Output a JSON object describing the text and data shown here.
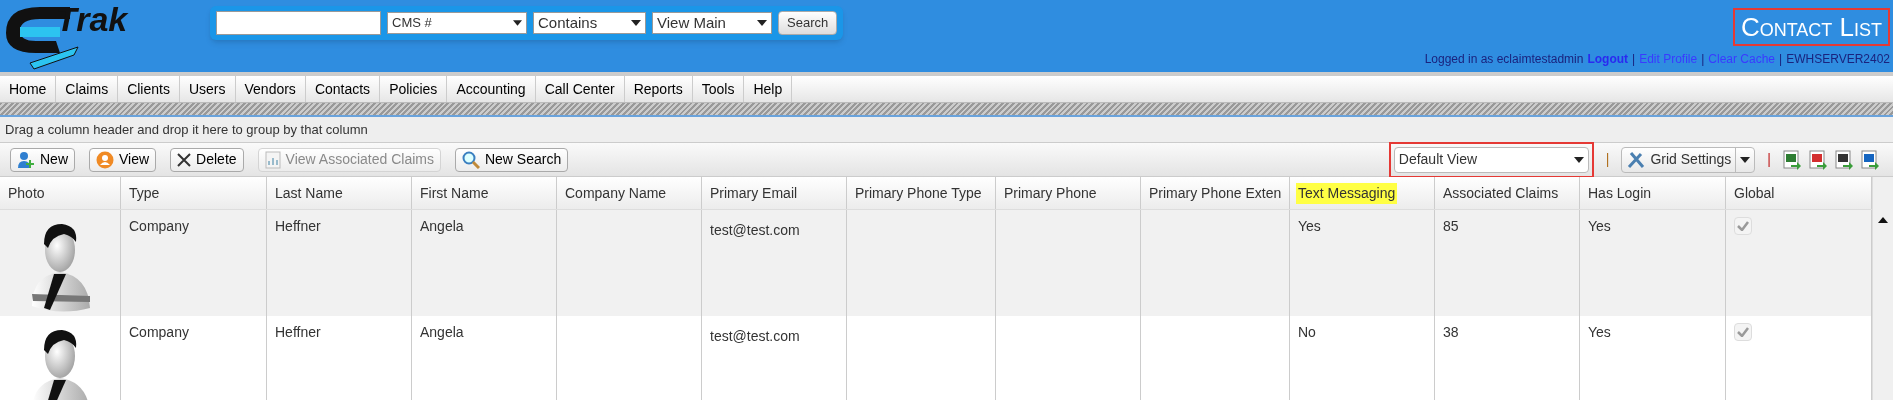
{
  "header": {
    "logo_text": "Trak",
    "search": {
      "field_select": "CMS #",
      "match_select": "Contains",
      "view_select": "View Main",
      "button": "Search"
    },
    "title": {
      "text": "Contact List",
      "outlined": true
    },
    "user_bar": [
      {
        "kind": "text",
        "text": "Logged in as eclaimtestadmin"
      },
      {
        "kind": "bold-link",
        "text": "Logout"
      },
      {
        "kind": "sep",
        "text": "|"
      },
      {
        "kind": "link",
        "text": "Edit Profile"
      },
      {
        "kind": "sep",
        "text": "|"
      },
      {
        "kind": "link",
        "text": "Clear Cache"
      },
      {
        "kind": "sep",
        "text": "|"
      },
      {
        "kind": "text",
        "text": "EWHSERVER2402"
      }
    ]
  },
  "menu": [
    "Home",
    "Claims",
    "Clients",
    "Users",
    "Vendors",
    "Contacts",
    "Policies",
    "Accounting",
    "Call Center",
    "Reports",
    "Tools",
    "Help"
  ],
  "group_panel": "Drag a column header and drop it here to group by that column",
  "toolbar": {
    "buttons": [
      {
        "kind": "new",
        "label": "New",
        "disabled": false
      },
      {
        "kind": "view",
        "label": "View",
        "disabled": false
      },
      {
        "kind": "delete",
        "label": "Delete",
        "disabled": false
      },
      {
        "kind": "claims",
        "label": "View Associated Claims",
        "disabled": true
      },
      {
        "kind": "search",
        "label": "New Search",
        "disabled": false
      }
    ],
    "view_select": {
      "value": "Default View",
      "outlined": true
    },
    "separators": [
      "|",
      "|"
    ],
    "grid_settings": "Grid Settings",
    "exports": [
      {
        "kind": "excel"
      },
      {
        "kind": "pdf"
      },
      {
        "kind": "csv"
      },
      {
        "kind": "word"
      }
    ]
  },
  "table": {
    "columns": [
      {
        "label": "Photo",
        "highlighted": false
      },
      {
        "label": "Type",
        "highlighted": false
      },
      {
        "label": "Last Name",
        "highlighted": false
      },
      {
        "label": "First Name",
        "highlighted": false
      },
      {
        "label": "Company Name",
        "highlighted": false
      },
      {
        "label": "Primary Email",
        "highlighted": false
      },
      {
        "label": "Primary Phone Type",
        "highlighted": false
      },
      {
        "label": "Primary Phone",
        "highlighted": false
      },
      {
        "label": "Primary Phone Exten",
        "highlighted": false
      },
      {
        "label": "Text Messaging",
        "highlighted": true
      },
      {
        "label": "Associated Claims",
        "highlighted": false
      },
      {
        "label": "Has Login",
        "highlighted": false
      },
      {
        "label": "Global",
        "highlighted": false
      }
    ],
    "rows": [
      {
        "selected": true,
        "type": "Company",
        "last_name": "Heffner",
        "first_name": "Angela",
        "primary_email": "test@test.com",
        "text_messaging": "Yes",
        "associated_claims": "85",
        "has_login": "Yes",
        "global": {
          "checked": true,
          "disabled": true
        }
      },
      {
        "selected": false,
        "type": "Company",
        "last_name": "Heffner",
        "first_name": "Angela",
        "primary_email": "test@test.com",
        "text_messaging": "No",
        "associated_claims": "38",
        "has_login": "Yes",
        "global": {
          "checked": true,
          "disabled": true
        }
      }
    ]
  }
}
